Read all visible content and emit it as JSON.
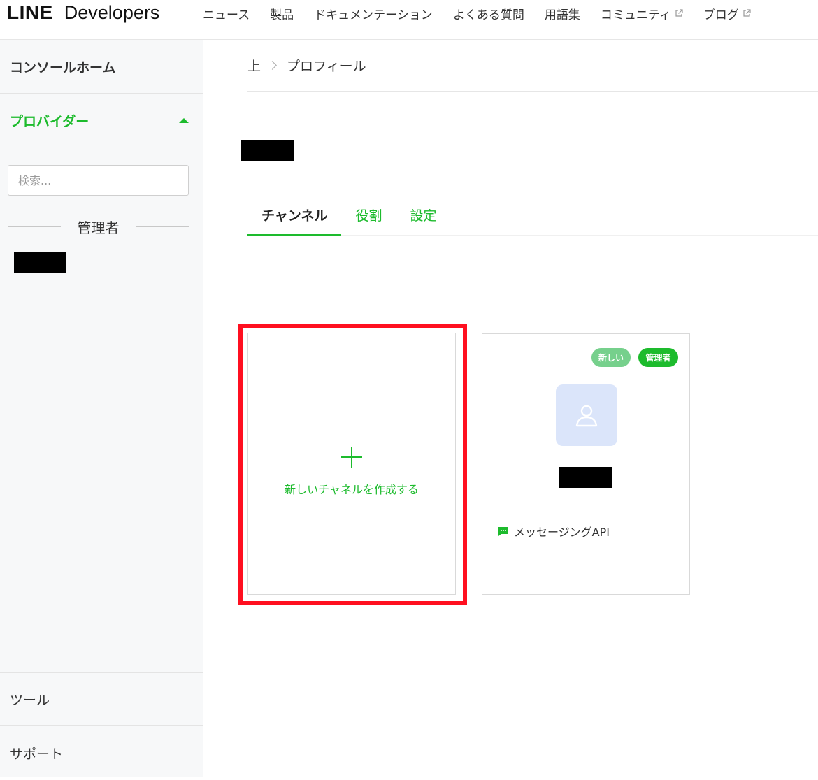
{
  "header": {
    "logo_line": "LINE",
    "logo_developers": "Developers",
    "nav": [
      {
        "label": "ニュース",
        "external": false
      },
      {
        "label": "製品",
        "external": false
      },
      {
        "label": "ドキュメンテーション",
        "external": false
      },
      {
        "label": "よくある質問",
        "external": false
      },
      {
        "label": "用語集",
        "external": false
      },
      {
        "label": "コミュニティ",
        "external": true
      },
      {
        "label": "ブログ",
        "external": true
      }
    ]
  },
  "sidebar": {
    "home": "コンソールホーム",
    "providers": "プロバイダー",
    "search_placeholder": "検索...",
    "role_header": "管理者",
    "tools": "ツール",
    "support": "サポート"
  },
  "main": {
    "breadcrumb": [
      "上",
      "プロフィール"
    ],
    "tabs": [
      {
        "label": "チャンネル",
        "active": true
      },
      {
        "label": "役割",
        "active": false
      },
      {
        "label": "設定",
        "active": false
      }
    ],
    "create_card": {
      "label": "新しいチャネルを作成する"
    },
    "channel_card": {
      "badge_new": "新しい",
      "badge_admin": "管理者",
      "type": "メッセージングAPI"
    }
  },
  "colors": {
    "brand_green": "#1dbb2d",
    "highlight_red": "#ff0f20",
    "badge_light_green": "#76d08c",
    "avatar_bg": "#dbe5fa"
  }
}
